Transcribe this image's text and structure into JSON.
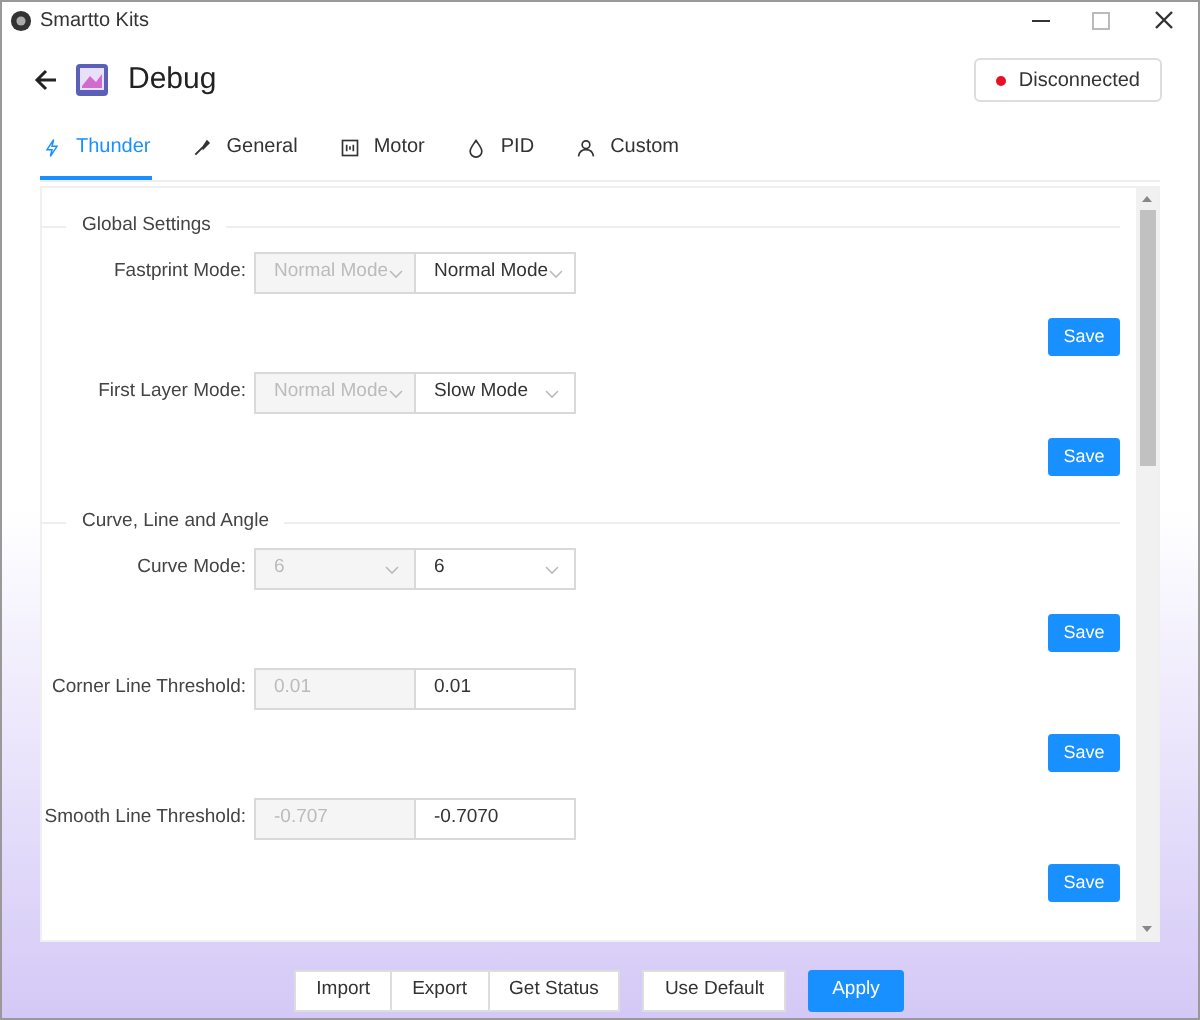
{
  "window": {
    "title": "Smartto Kits"
  },
  "header": {
    "title": "Debug",
    "connection": {
      "label": "Disconnected",
      "connected": false
    }
  },
  "tabs": [
    {
      "label": "Thunder",
      "selected": true
    },
    {
      "label": "General",
      "selected": false
    },
    {
      "label": "Motor",
      "selected": false
    },
    {
      "label": "PID",
      "selected": false
    },
    {
      "label": "Custom",
      "selected": false
    }
  ],
  "sections": [
    {
      "title": "Global Settings",
      "rows": [
        {
          "kind": "select",
          "label": "Fastprint Mode:",
          "current": "Normal Mode",
          "value": "Normal Mode",
          "save": "Save"
        },
        {
          "kind": "select",
          "label": "First Layer Mode:",
          "current": "Normal Mode",
          "value": "Slow Mode",
          "save": "Save"
        }
      ]
    },
    {
      "title": "Curve, Line and Angle",
      "rows": [
        {
          "kind": "select",
          "label": "Curve Mode:",
          "current": "6",
          "value": "6",
          "save": "Save"
        },
        {
          "kind": "input",
          "label": "Corner Line Threshold:",
          "current": "0.01",
          "value": "0.01",
          "save": "Save"
        },
        {
          "kind": "input",
          "label": "Smooth Line Threshold:",
          "current": "-0.707",
          "value": "-0.7070",
          "save": "Save"
        }
      ]
    }
  ],
  "footer": [
    {
      "label": "Import",
      "kind": "joined"
    },
    {
      "label": "Export",
      "kind": "joined"
    },
    {
      "label": "Get Status",
      "kind": "joined"
    },
    {
      "label": "Use Default",
      "kind": "plain"
    },
    {
      "label": "Apply",
      "kind": "primary"
    }
  ]
}
